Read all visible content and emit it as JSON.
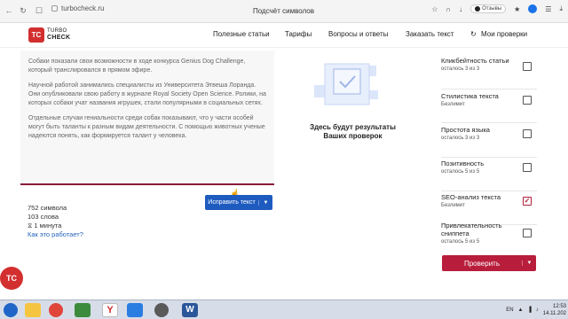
{
  "browser": {
    "url": "turbocheck.ru",
    "tab_title": "Подсчёт символов",
    "reviews_label": "Отзывы"
  },
  "header": {
    "logo_mark": "TC",
    "logo_line1": "TURBO",
    "logo_line2": "CHECK",
    "nav": [
      "Полезные статьи",
      "Тарифы",
      "Вопросы и ответы",
      "Заказать текст",
      "Мои проверки"
    ]
  },
  "editor": {
    "paragraphs": [
      "Собаки показали свои возможности в ходе конкурса Genius Dog Challenge, который транслировался в прямом эфире.",
      "Научной работой занимались специалисты из Университета Этвеша Лоранда. Они опубликовали свою работу в журнале Royal Society Open Science. Ролики, на которых собаки учат названия игрушек, стали популярными в социальных сетях.",
      "Отдельные случаи гениальности среди собак показывают, что у части особей могут быть таланты к разным видам деятельности. С помощью животных ученые надеются понять, как формируется талант у человека."
    ]
  },
  "stats": {
    "chars": "752 символа",
    "words": "103 слова",
    "time": "1 минута",
    "how_link": "Как это работает?"
  },
  "fix_button": {
    "label": "Исправить текст"
  },
  "results_placeholder": {
    "line1": "Здесь будут результаты",
    "line2": "Ваших проверок"
  },
  "checks": [
    {
      "title": "Кликбейтность статьи",
      "sub": "осталось 3 из 3",
      "checked": false
    },
    {
      "title": "Стилистика текста",
      "sub": "Безлимит",
      "checked": false
    },
    {
      "title": "Простота языка",
      "sub": "осталось 3 из 3",
      "checked": false
    },
    {
      "title": "Позитивность",
      "sub": "осталось 5 из 5",
      "checked": false
    },
    {
      "title": "SEO-анализ текста",
      "sub": "Безлимит",
      "checked": true
    },
    {
      "title": "Привлекательность сниппета",
      "sub": "осталось 5 из 5",
      "checked": false
    }
  ],
  "check_button": {
    "label": "Проверить"
  },
  "taskbar": {
    "lang": "EN",
    "time": "12:53",
    "date": "14.11.202",
    "colors": [
      "#1f66c8",
      "#f5c542",
      "#e0453a",
      "#3c8b3c",
      "#2a7de1",
      "#5a5a5a",
      "#d12c2c",
      "#ffffff",
      "#2b579a"
    ]
  }
}
